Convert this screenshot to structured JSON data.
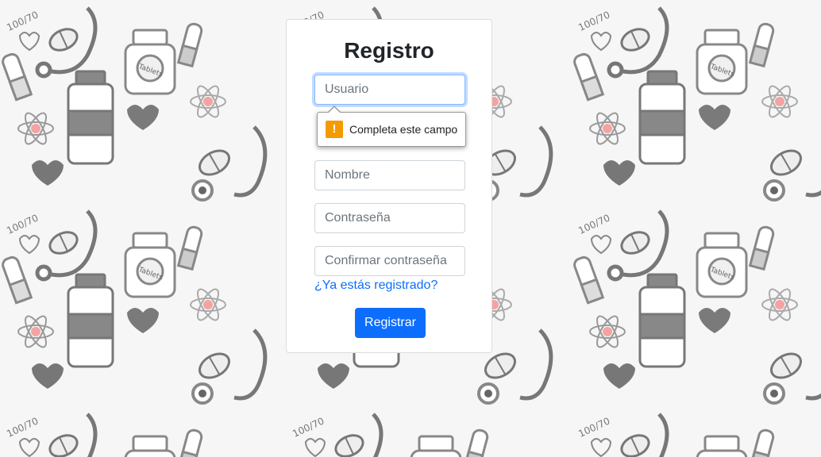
{
  "form": {
    "title": "Registro",
    "usuario_placeholder": "Usuario",
    "nombre_placeholder": "Nombre",
    "contrasena_placeholder": "Contraseña",
    "confirmar_placeholder": "Confirmar contraseña",
    "login_link": "¿Ya estás registrado?",
    "submit_label": "Registrar"
  },
  "validation": {
    "icon": "warning-icon",
    "symbol": "!",
    "message": "Completa este campo"
  },
  "background": {
    "pattern": "medical-doodle",
    "doodle_text": [
      "Tablets",
      "100/70"
    ]
  },
  "colors": {
    "primary": "#0d6efd",
    "warning": "#f29b00",
    "doodle": "#808080",
    "doodle_accent": "#f4a3a3"
  }
}
